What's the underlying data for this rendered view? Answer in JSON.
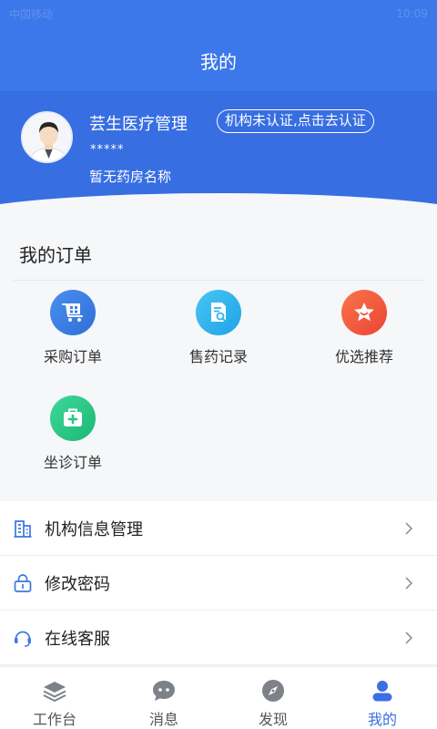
{
  "header": {
    "title": "我的",
    "status_left": "中国移动",
    "status_right": "10:09"
  },
  "profile": {
    "org_name": "芸生医疗管理",
    "cert_badge": "机构未认证,点击去认证",
    "masked": "*****",
    "pharmacy": "暂无药房名称"
  },
  "orders": {
    "title": "我的订单",
    "items": [
      {
        "label": "采购订单",
        "icon": "cart-icon",
        "color": "#3b7fe4"
      },
      {
        "label": "售药记录",
        "icon": "document-search-icon",
        "color": "#2fb2ef"
      },
      {
        "label": "优选推荐",
        "icon": "star-icon",
        "color": "#f2593f"
      },
      {
        "label": "坐诊订单",
        "icon": "medical-kit-icon",
        "color": "#27c886"
      }
    ]
  },
  "menu": [
    {
      "label": "机构信息管理",
      "icon": "building-icon"
    },
    {
      "label": "修改密码",
      "icon": "lock-icon"
    },
    {
      "label": "在线客服",
      "icon": "headset-icon"
    }
  ],
  "tabs": [
    {
      "label": "工作台",
      "icon": "layers-icon",
      "active": false
    },
    {
      "label": "消息",
      "icon": "chat-icon",
      "active": false
    },
    {
      "label": "发现",
      "icon": "compass-icon",
      "active": false
    },
    {
      "label": "我的",
      "icon": "user-icon",
      "active": true
    }
  ],
  "colors": {
    "primary": "#3c78ea",
    "active_tab": "#3c6ee6",
    "icon_blue": "#3b78e0"
  }
}
